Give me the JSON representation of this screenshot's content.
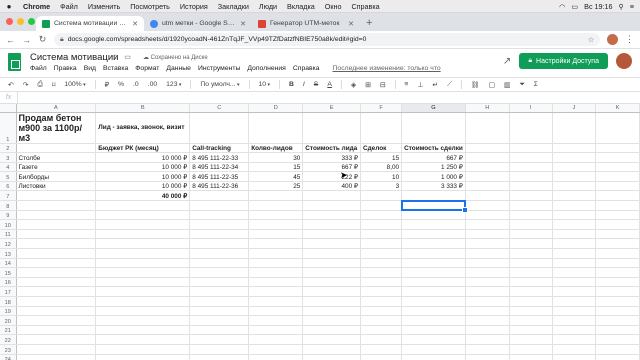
{
  "macmenu": {
    "apple": "",
    "items": [
      "Chrome",
      "Файл",
      "Изменить",
      "Посмотреть",
      "История",
      "Закладки",
      "Люди",
      "Вкладка",
      "Окно",
      "Справка"
    ],
    "clock": "Вс 19:16"
  },
  "tabs": [
    {
      "title": "Система мотивации - Google ...",
      "active": true,
      "color": "#0f9d58"
    },
    {
      "title": "utm метки - Google Search",
      "active": false,
      "color": "#4285f4"
    },
    {
      "title": "Генератор UTM-меток",
      "active": false,
      "color": "#db4437"
    }
  ],
  "omnibox": {
    "url": "docs.google.com/spreadsheets/d/1920ycoadN-461ZnTqJF_VVp49TZfDatzfNBIE750a8k/edit#gid=0"
  },
  "sheet": {
    "title": "Система мотивации",
    "saved_status": "Сохранено на Диске",
    "menus": [
      "Файл",
      "Правка",
      "Вид",
      "Вставка",
      "Формат",
      "Данные",
      "Инструменты",
      "Дополнения",
      "Справка"
    ],
    "last_edit": "Последнее изменение: только что",
    "share_label": "Настройки Доступа"
  },
  "toolbar": {
    "zoom": "100%",
    "currency": "₽",
    "percent": "%",
    "dec0": ".0",
    "dec00": ".00",
    "format": "123",
    "font": "По умолч...",
    "size": "10",
    "bold": "B",
    "italic": "I",
    "strike": "S",
    "textcolor": "A"
  },
  "formula": {
    "fx": "fx",
    "value": ""
  },
  "grid": {
    "columns": [
      "A",
      "B",
      "C",
      "D",
      "E",
      "F",
      "G",
      "H",
      "I",
      "J",
      "K"
    ],
    "selected_col": "G",
    "rows": [
      {
        "n": "1",
        "cells": [
          "Продам бетон м900 за 1100р/м3",
          "Лид - заявка, звонок, визит",
          "",
          "",
          "",
          "",
          "",
          "",
          "",
          "",
          ""
        ]
      },
      {
        "n": "2",
        "cells": [
          "",
          "Бюджет РК (месяц)",
          "Call-tracking",
          "Колво-лидов",
          "Стоимость лида",
          "Сделок",
          "Стоимость сделки",
          "",
          "",
          "",
          ""
        ]
      },
      {
        "n": "3",
        "cells": [
          "Столбе",
          "10 000 ₽",
          "8 495 111-22-33",
          "30",
          "333 ₽",
          "15",
          "667 ₽",
          "",
          "",
          "",
          ""
        ]
      },
      {
        "n": "4",
        "cells": [
          "Газете",
          "10 000 ₽",
          "8 495 111-22-34",
          "15",
          "667 ₽",
          "8,00",
          "1 250 ₽",
          "",
          "",
          "",
          ""
        ]
      },
      {
        "n": "5",
        "cells": [
          "Билборды",
          "10 000 ₽",
          "8 495 111-22-35",
          "45",
          "222 ₽",
          "10",
          "1 000 ₽",
          "",
          "",
          "",
          ""
        ]
      },
      {
        "n": "6",
        "cells": [
          "Листовки",
          "10 000 ₽",
          "8 495 111-22-36",
          "25",
          "400 ₽",
          "3",
          "3 333 ₽",
          "",
          "",
          "",
          ""
        ]
      },
      {
        "n": "7",
        "cells": [
          "",
          "40 000 ₽",
          "",
          "",
          "",
          "",
          "",
          "",
          "",
          "",
          ""
        ]
      },
      {
        "n": "8",
        "cells": [
          "",
          "",
          "",
          "",
          "",
          "",
          "",
          "",
          "",
          "",
          ""
        ]
      },
      {
        "n": "9",
        "cells": [
          "",
          "",
          "",
          "",
          "",
          "",
          "",
          "",
          "",
          "",
          ""
        ]
      },
      {
        "n": "10",
        "cells": [
          "",
          "",
          "",
          "",
          "",
          "",
          "",
          "",
          "",
          "",
          ""
        ]
      },
      {
        "n": "11",
        "cells": [
          "",
          "",
          "",
          "",
          "",
          "",
          "",
          "",
          "",
          "",
          ""
        ]
      },
      {
        "n": "12",
        "cells": [
          "",
          "",
          "",
          "",
          "",
          "",
          "",
          "",
          "",
          "",
          ""
        ]
      },
      {
        "n": "13",
        "cells": [
          "",
          "",
          "",
          "",
          "",
          "",
          "",
          "",
          "",
          "",
          ""
        ]
      },
      {
        "n": "14",
        "cells": [
          "",
          "",
          "",
          "",
          "",
          "",
          "",
          "",
          "",
          "",
          ""
        ]
      },
      {
        "n": "15",
        "cells": [
          "",
          "",
          "",
          "",
          "",
          "",
          "",
          "",
          "",
          "",
          ""
        ]
      },
      {
        "n": "16",
        "cells": [
          "",
          "",
          "",
          "",
          "",
          "",
          "",
          "",
          "",
          "",
          ""
        ]
      },
      {
        "n": "17",
        "cells": [
          "",
          "",
          "",
          "",
          "",
          "",
          "",
          "",
          "",
          "",
          ""
        ]
      },
      {
        "n": "18",
        "cells": [
          "",
          "",
          "",
          "",
          "",
          "",
          "",
          "",
          "",
          "",
          ""
        ]
      },
      {
        "n": "19",
        "cells": [
          "",
          "",
          "",
          "",
          "",
          "",
          "",
          "",
          "",
          "",
          ""
        ]
      },
      {
        "n": "20",
        "cells": [
          "",
          "",
          "",
          "",
          "",
          "",
          "",
          "",
          "",
          "",
          ""
        ]
      },
      {
        "n": "21",
        "cells": [
          "",
          "",
          "",
          "",
          "",
          "",
          "",
          "",
          "",
          "",
          ""
        ]
      },
      {
        "n": "22",
        "cells": [
          "",
          "",
          "",
          "",
          "",
          "",
          "",
          "",
          "",
          "",
          ""
        ]
      },
      {
        "n": "23",
        "cells": [
          "",
          "",
          "",
          "",
          "",
          "",
          "",
          "",
          "",
          "",
          ""
        ]
      },
      {
        "n": "24",
        "cells": [
          "",
          "",
          "",
          "",
          "",
          "",
          "",
          "",
          "",
          "",
          ""
        ]
      }
    ]
  }
}
